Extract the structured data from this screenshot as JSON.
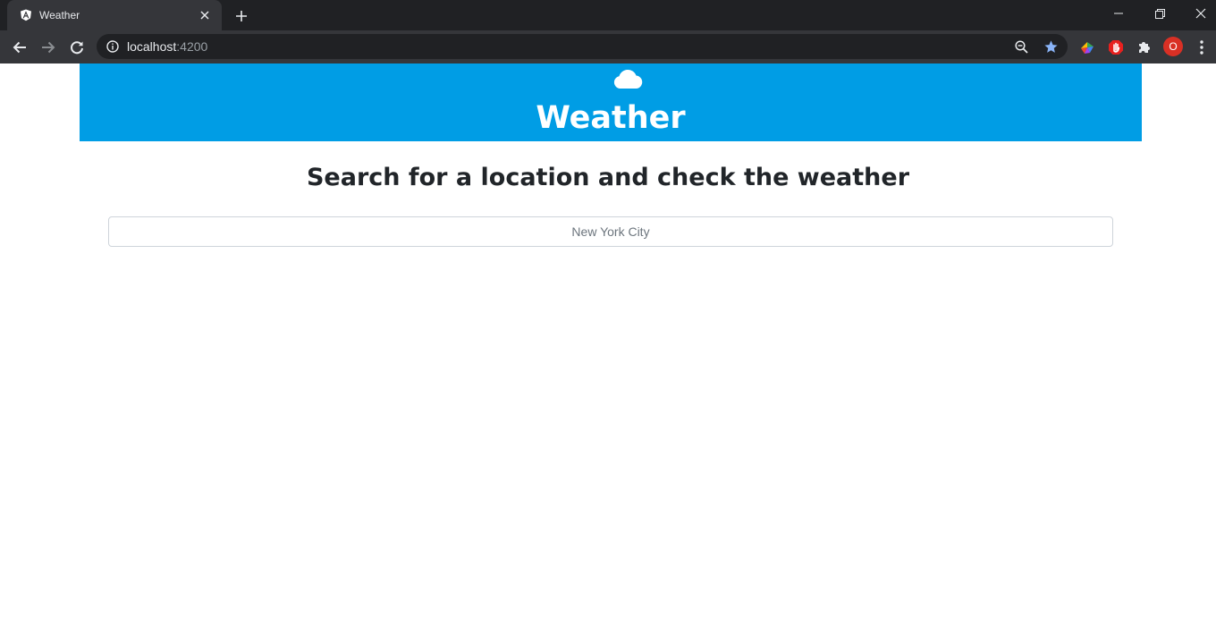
{
  "browser": {
    "tab": {
      "title": "Weather",
      "favicon": "angular-logo-icon"
    },
    "url": {
      "host": "localhost",
      "port": ":4200"
    },
    "profile_initial": "O",
    "accent_colors": {
      "star": "#8ab4f8",
      "profile": "#d93025"
    }
  },
  "app": {
    "header": {
      "icon": "cloud-icon",
      "title": "Weather",
      "background": "#009de5"
    },
    "subtitle": "Search for a location and check the weather",
    "search": {
      "value": "",
      "placeholder": "New York City"
    }
  }
}
